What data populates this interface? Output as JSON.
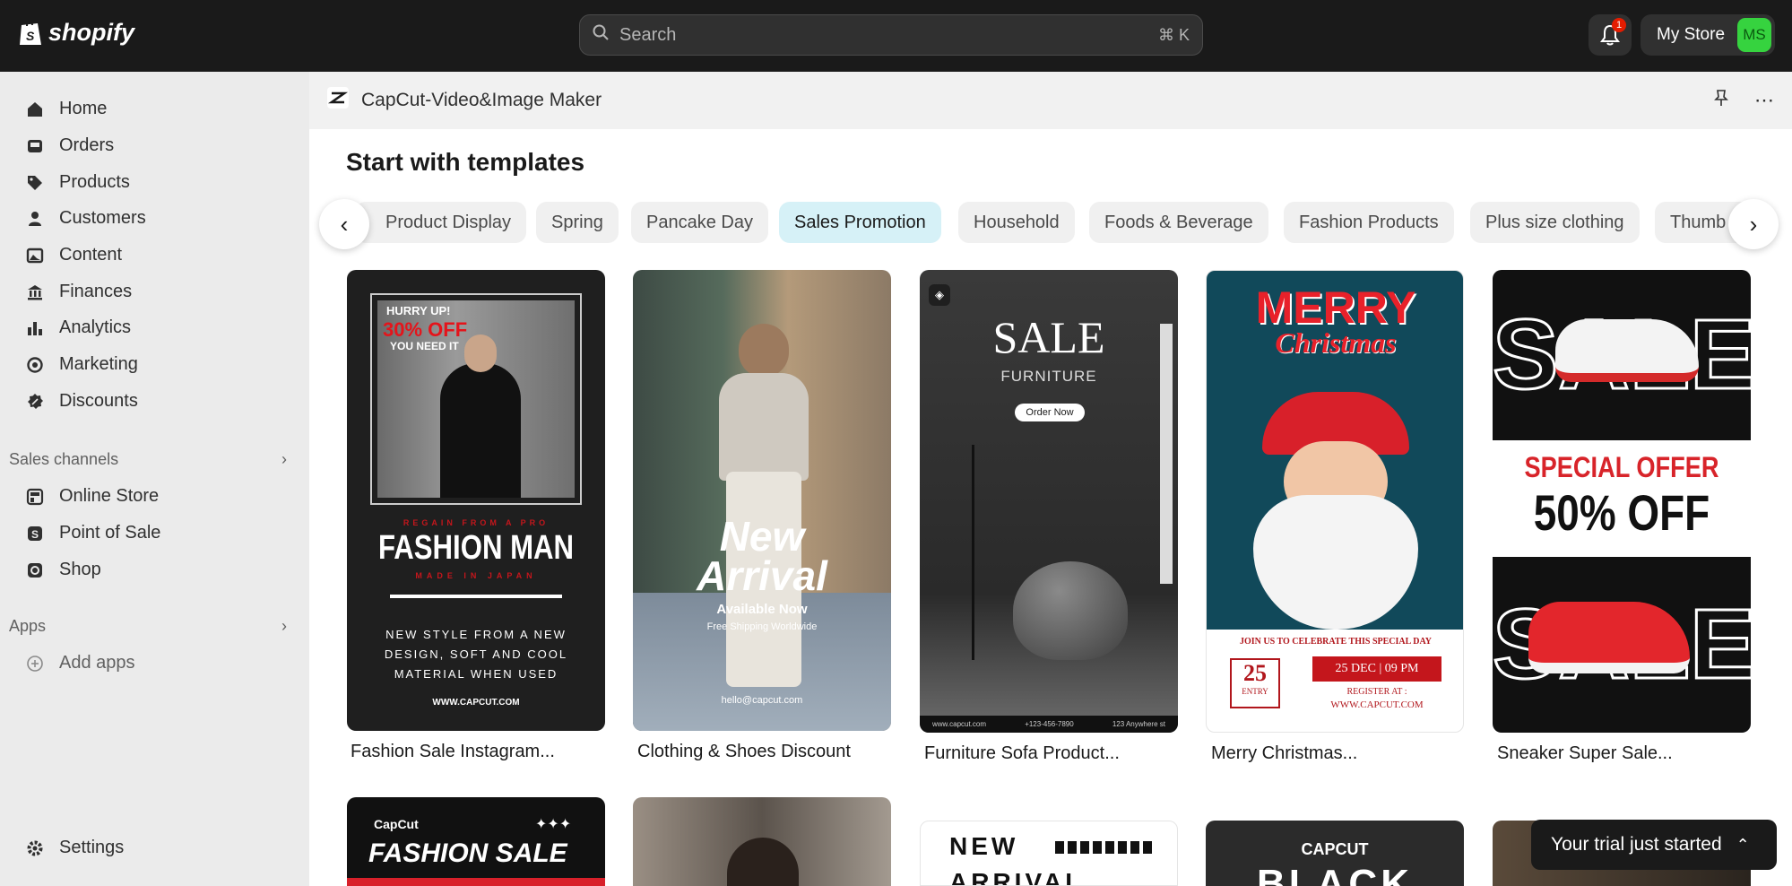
{
  "topbar": {
    "logo": "shopify",
    "search_placeholder": "Search",
    "search_shortcut": "⌘ K",
    "notifications_count": "1",
    "store_name": "My Store",
    "avatar_initials": "MS"
  },
  "sidebar": {
    "items": [
      {
        "label": "Home",
        "icon": "home-icon"
      },
      {
        "label": "Orders",
        "icon": "inbox-icon"
      },
      {
        "label": "Products",
        "icon": "tag-icon"
      },
      {
        "label": "Customers",
        "icon": "person-icon"
      },
      {
        "label": "Content",
        "icon": "image-icon"
      },
      {
        "label": "Finances",
        "icon": "bank-icon"
      },
      {
        "label": "Analytics",
        "icon": "bar-chart-icon"
      },
      {
        "label": "Marketing",
        "icon": "target-icon"
      },
      {
        "label": "Discounts",
        "icon": "discount-icon"
      }
    ],
    "sales_channels_label": "Sales channels",
    "channels": [
      {
        "label": "Online Store"
      },
      {
        "label": "Point of Sale"
      },
      {
        "label": "Shop"
      }
    ],
    "apps_label": "Apps",
    "add_apps": "Add apps",
    "settings": "Settings"
  },
  "app": {
    "title": "CapCut-Video&Image Maker",
    "heading": "Start with templates",
    "categories": [
      "Product Display",
      "Spring",
      "Pancake Day",
      "Sales Promotion",
      "Household",
      "Foods & Beverage",
      "Fashion Products",
      "Plus size clothing",
      "Thumb"
    ],
    "active_category": "Sales Promotion",
    "templates": [
      {
        "name": "Fashion Sale Instagram...",
        "lines": [
          "HURRY UP!",
          "30% OFF",
          "YOU NEED IT",
          "REGAIN FROM A PRO",
          "FASHION MAN",
          "MADE IN JAPAN",
          "NEW STYLE FROM A NEW",
          "DESIGN, SOFT AND COOL",
          "MATERIAL WHEN USED",
          "WWW.CAPCUT.COM"
        ]
      },
      {
        "name": "Clothing & Shoes Discount",
        "lines": [
          "New",
          "Arrival",
          "Available Now",
          "Free Shipping Worldwide",
          "hello@capcut.com"
        ]
      },
      {
        "name": "Furniture Sofa Product...",
        "lines": [
          "SALE",
          "FURNITURE",
          "Order Now",
          "www.capcut.com",
          "+123-456-7890",
          "123 Anywhere st"
        ]
      },
      {
        "name": "Merry Christmas...",
        "lines": [
          "MERRY",
          "Christmas",
          "JOIN US TO CELEBRATE THIS SPECIAL DAY",
          "25",
          "ENTRY",
          "25 DEC | 09 PM",
          "REGISTER AT :",
          "WWW.CAPCUT.COM"
        ]
      },
      {
        "name": "Sneaker Super Sale...",
        "lines": [
          "SALE",
          "SPECIAL OFFER",
          "50% OFF",
          "SALE"
        ]
      }
    ],
    "row2": [
      {
        "lines": [
          "CapCut",
          "FASHION SALE"
        ]
      },
      {
        "lines": []
      },
      {
        "lines": [
          "NEW",
          "ARRIVAL"
        ]
      },
      {
        "lines": [
          "CAPCUT",
          "BLACK"
        ]
      },
      {
        "lines": []
      }
    ]
  },
  "toast": {
    "label": "Your trial just started"
  }
}
